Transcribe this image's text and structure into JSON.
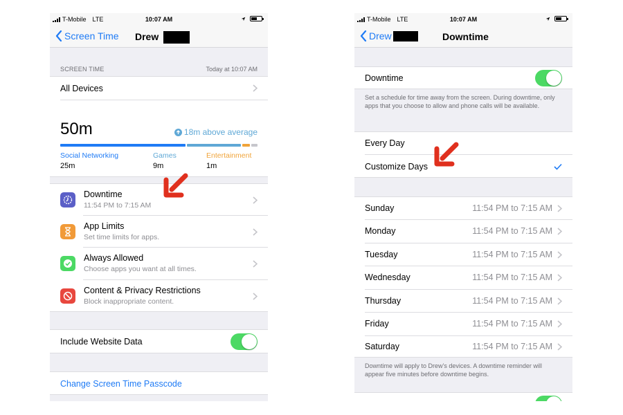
{
  "left": {
    "status": {
      "carrier": "T-Mobile",
      "network": "LTE",
      "time": "10:07 AM"
    },
    "nav": {
      "back_label": "Screen Time",
      "title": "Drew"
    },
    "screen_time": {
      "header": "SCREEN TIME",
      "header_right": "Today at 10:07 AM",
      "all_devices": "All Devices",
      "total": "50m",
      "above_average": "18m above average",
      "categories": [
        {
          "name": "Social Networking",
          "value": "25m",
          "color": "#1f7bf5"
        },
        {
          "name": "Games",
          "value": "9m",
          "color": "#5fa8d6"
        },
        {
          "name": "Entertainment",
          "value": "1m",
          "color": "#f0a43a"
        }
      ]
    },
    "items": [
      {
        "title": "Downtime",
        "subtitle": "11:54 PM to 7:15 AM",
        "icon": "downtime-icon",
        "color": "#5b5fc7"
      },
      {
        "title": "App Limits",
        "subtitle": "Set time limits for apps.",
        "icon": "hourglass-icon",
        "color": "#f19a38"
      },
      {
        "title": "Always Allowed",
        "subtitle": "Choose apps you want at all times.",
        "icon": "checkmark-badge-icon",
        "color": "#4cd964"
      },
      {
        "title": "Content & Privacy Restrictions",
        "subtitle": "Block inappropriate content.",
        "icon": "no-entry-icon",
        "color": "#e8473e"
      }
    ],
    "include_website": {
      "label": "Include Website Data",
      "on": true
    },
    "change_passcode": "Change Screen Time Passcode"
  },
  "right": {
    "status": {
      "carrier": "T-Mobile",
      "network": "LTE",
      "time": "10:07 AM"
    },
    "nav": {
      "back_label": "Drew",
      "title": "Downtime"
    },
    "downtime_toggle": {
      "label": "Downtime",
      "on": true
    },
    "description": "Set a schedule for time away from the screen. During downtime, only apps that you choose to allow and phone calls will be available.",
    "schedule_options": [
      {
        "label": "Every Day",
        "selected": false
      },
      {
        "label": "Customize Days",
        "selected": true
      }
    ],
    "days": [
      {
        "day": "Sunday",
        "time": "11:54 PM to 7:15 AM"
      },
      {
        "day": "Monday",
        "time": "11:54 PM to 7:15 AM"
      },
      {
        "day": "Tuesday",
        "time": "11:54 PM to 7:15 AM"
      },
      {
        "day": "Wednesday",
        "time": "11:54 PM to 7:15 AM"
      },
      {
        "day": "Thursday",
        "time": "11:54 PM to 7:15 AM"
      },
      {
        "day": "Friday",
        "time": "11:54 PM to 7:15 AM"
      },
      {
        "day": "Saturday",
        "time": "11:54 PM to 7:15 AM"
      }
    ],
    "footer": "Downtime will apply to Drew’s devices. A downtime reminder will appear five minutes before downtime begins."
  },
  "colors": {
    "accent": "#1f7bf5",
    "toggle_on": "#4cd964",
    "annotation_arrow": "#e0301e"
  }
}
